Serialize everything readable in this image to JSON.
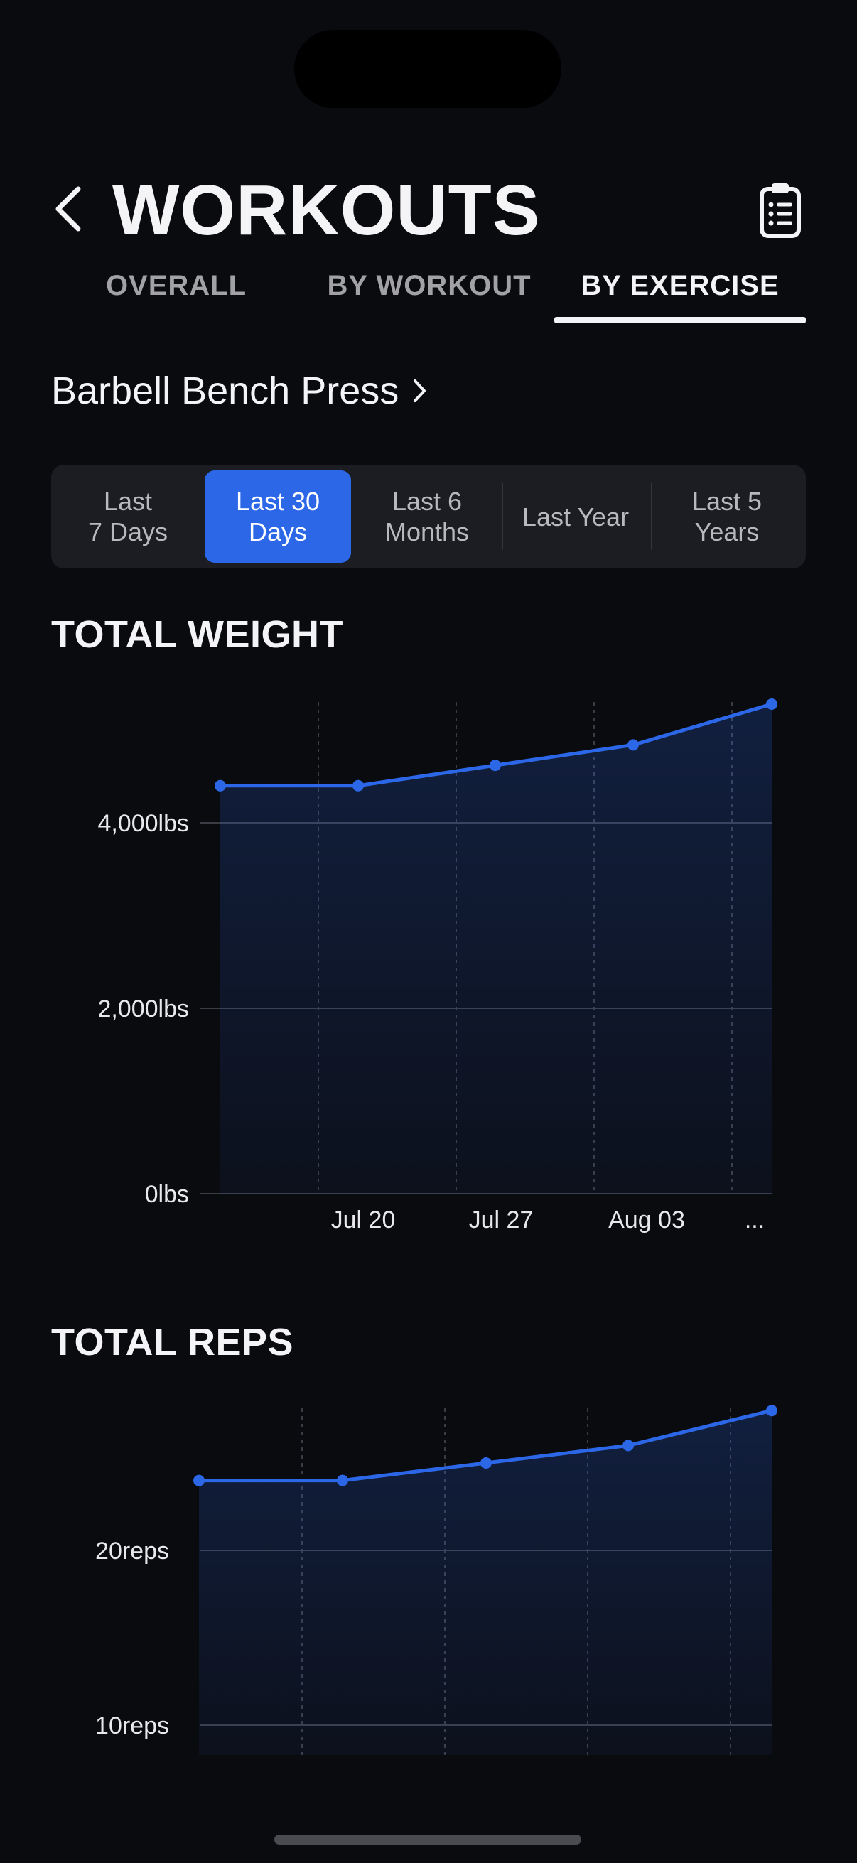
{
  "header": {
    "title": "WORKOUTS",
    "back_icon": "chevron-left-icon",
    "action_icon": "clipboard-list-icon"
  },
  "tabs": [
    {
      "label": "OVERALL",
      "active": false
    },
    {
      "label": "BY WORKOUT",
      "active": false
    },
    {
      "label": "BY EXERCISE",
      "active": true
    }
  ],
  "exercise": {
    "name": "Barbell Bench Press",
    "chevron_icon": "chevron-right-icon"
  },
  "ranges": [
    {
      "label": "Last\n7 Days",
      "active": false
    },
    {
      "label": "Last 30\nDays",
      "active": true
    },
    {
      "label": "Last 6\nMonths",
      "active": false
    },
    {
      "label": "Last Year",
      "active": false
    },
    {
      "label": "Last 5\nYears",
      "active": false
    }
  ],
  "colors": {
    "accent": "#2c67e8",
    "background": "#0a0b0f"
  },
  "weight_section": {
    "title": "TOTAL WEIGHT"
  },
  "reps_section": {
    "title": "TOTAL REPS"
  },
  "chart_data": [
    {
      "type": "area",
      "y_tick_labels": [
        "0lbs",
        "2,000lbs",
        "4,000lbs"
      ],
      "y_ticks": [
        0,
        2000,
        4000
      ],
      "x_tick_labels": [
        "Jul 20",
        "Jul 27",
        "Aug 03",
        "..."
      ],
      "ylim": [
        0,
        5300
      ],
      "values": [
        4400,
        4400,
        4620,
        4840,
        5280
      ],
      "grid": true
    },
    {
      "type": "area",
      "y_tick_labels": [
        "10reps",
        "20reps"
      ],
      "y_ticks": [
        10,
        20
      ],
      "values": [
        24,
        24,
        25,
        26,
        28
      ],
      "grid": true
    }
  ]
}
